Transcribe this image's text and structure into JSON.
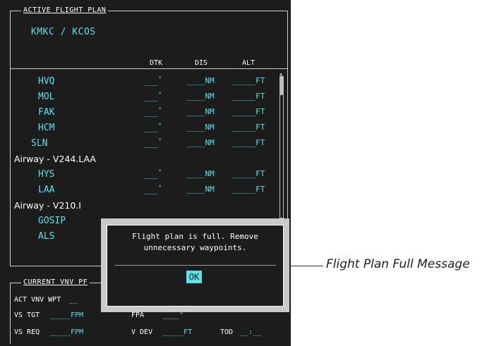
{
  "flight_plan": {
    "title": "ACTIVE FLIGHT PLAN",
    "route": "KMKC / KCOS",
    "col_dtk": "DTK",
    "col_dis": "DIS",
    "col_alt": "ALT",
    "rows": [
      {
        "type": "wpt",
        "name": "HVQ",
        "dtk": "___",
        "dis": "____NM",
        "alt": "_____FT"
      },
      {
        "type": "wpt",
        "name": "MOL",
        "dtk": "___",
        "dis": "____NM",
        "alt": "_____FT"
      },
      {
        "type": "wpt",
        "name": "FAK",
        "dtk": "___",
        "dis": "____NM",
        "alt": "_____FT"
      },
      {
        "type": "wpt",
        "name": "HCM",
        "dtk": "___",
        "dis": "____NM",
        "alt": "_____FT"
      },
      {
        "type": "wpt",
        "name": "SLN",
        "dtk": "___",
        "dis": "____NM",
        "alt": "_____FT"
      },
      {
        "type": "airway",
        "name": "Airway - V244.LAA"
      },
      {
        "type": "wpt",
        "name": "HYS",
        "dtk": "___",
        "dis": "____NM",
        "alt": "_____FT"
      },
      {
        "type": "wpt",
        "name": "LAA",
        "dtk": "___",
        "dis": "____NM",
        "alt": "_____FT"
      },
      {
        "type": "airway",
        "name": "Airway - V210.I"
      },
      {
        "type": "wpt",
        "name": "GOSIP"
      },
      {
        "type": "wpt",
        "name": "ALS"
      }
    ]
  },
  "vnv": {
    "title": "CURRENT VNV PF",
    "act_label": "ACT VNV WPT",
    "act_value": "__",
    "vs_tgt_label": "VS TGT",
    "vs_tgt_value": "_____FPM",
    "fpa_label": "FPA",
    "fpa_value": "____°",
    "vs_req_label": "VS REQ",
    "vs_req_value": "_____FPM",
    "vdev_label": "V DEV",
    "vdev_value": "_____FT",
    "tod_label": "TOD",
    "tod_value": "__:__"
  },
  "dialog": {
    "line1": "Flight plan is full. Remove",
    "line2": "unnecessary waypoints.",
    "ok_label": "OK"
  },
  "callout": "Flight Plan Full Message",
  "colors": {
    "cyan": "#5ee0e8",
    "background": "#1c1c1c"
  }
}
